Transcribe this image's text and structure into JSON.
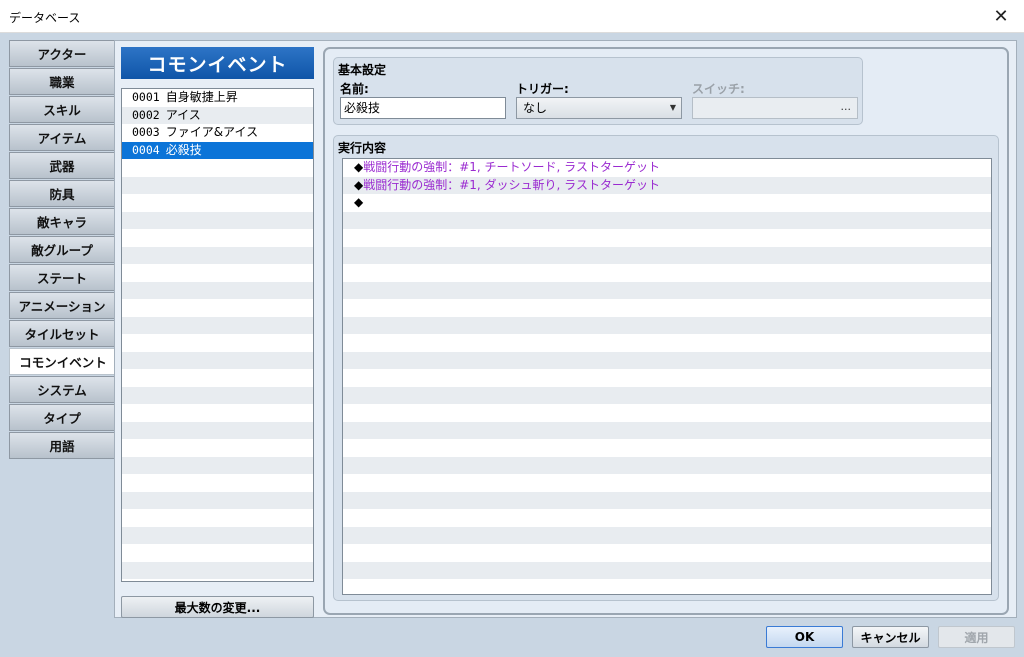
{
  "window": {
    "title": "データベース",
    "close_icon": "close-icon"
  },
  "tabs": [
    {
      "label": "アクター"
    },
    {
      "label": "職業"
    },
    {
      "label": "スキル"
    },
    {
      "label": "アイテム"
    },
    {
      "label": "武器"
    },
    {
      "label": "防具"
    },
    {
      "label": "敵キャラ"
    },
    {
      "label": "敵グループ"
    },
    {
      "label": "ステート"
    },
    {
      "label": "アニメーション"
    },
    {
      "label": "タイルセット"
    },
    {
      "label": "コモンイベント",
      "active": true
    },
    {
      "label": "システム"
    },
    {
      "label": "タイプ"
    },
    {
      "label": "用語"
    }
  ],
  "list": {
    "header": "コモンイベント",
    "items": [
      {
        "num": "0001",
        "name": "自身敏捷上昇"
      },
      {
        "num": "0002",
        "name": "アイス"
      },
      {
        "num": "0003",
        "name": "ファイア&アイス"
      },
      {
        "num": "0004",
        "name": "必殺技",
        "selected": true
      }
    ],
    "max_button": "最大数の変更..."
  },
  "basic": {
    "title": "基本設定",
    "name_label": "名前:",
    "name_value": "必殺技",
    "trigger_label": "トリガー:",
    "trigger_value": "なし",
    "switch_label": "スイッチ:",
    "switch_button": "..."
  },
  "contents": {
    "title": "実行内容",
    "commands": [
      {
        "marker": "◆",
        "text": "戦闘行動の強制：#1, チートソード, ラストターゲット"
      },
      {
        "marker": "◆",
        "text": "戦闘行動の強制：#1, ダッシュ斬り, ラストターゲット"
      },
      {
        "marker": "◆",
        "text": ""
      }
    ]
  },
  "footer": {
    "ok": "OK",
    "cancel": "キャンセル",
    "apply": "適用"
  },
  "colors": {
    "header_blue": "#0f55a8",
    "selected": "#0b74d8",
    "command_text": "#9a2ad0"
  }
}
